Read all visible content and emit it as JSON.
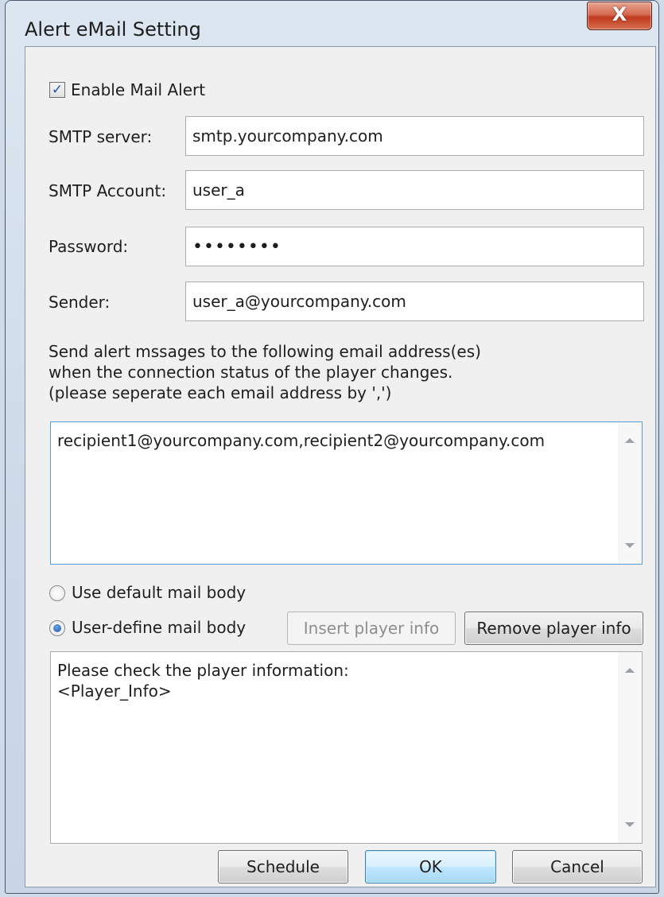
{
  "window": {
    "title": "Alert eMail Setting",
    "close_label": "X"
  },
  "enable_mail_alert": {
    "label": "Enable Mail Alert",
    "checked": true,
    "mark": "✓"
  },
  "smtp_server": {
    "label": "SMTP server:",
    "value": "smtp.yourcompany.com"
  },
  "smtp_account": {
    "label": "SMTP Account:",
    "value": "user_a"
  },
  "password": {
    "label": "Password:",
    "value": "••••••••"
  },
  "sender": {
    "label": "Sender:",
    "value": "user_a@yourcompany.com"
  },
  "instructions": {
    "line1": "Send alert mssages to the following email address(es)",
    "line2": "when the connection status of the player changes.",
    "line3": "(please seperate each email address by ',')"
  },
  "recipients": {
    "value": "recipient1@yourcompany.com,recipient2@yourcompany.com"
  },
  "mail_body": {
    "default_label": "Use default mail body",
    "user_define_label": "User-define mail body",
    "selected": "user-define",
    "insert_player_info": "Insert player info",
    "remove_player_info": "Remove player info",
    "body_line1": "Please check the player information:",
    "body_line2": "<Player_Info>"
  },
  "buttons": {
    "schedule": "Schedule",
    "ok": "OK",
    "cancel": "Cancel"
  }
}
